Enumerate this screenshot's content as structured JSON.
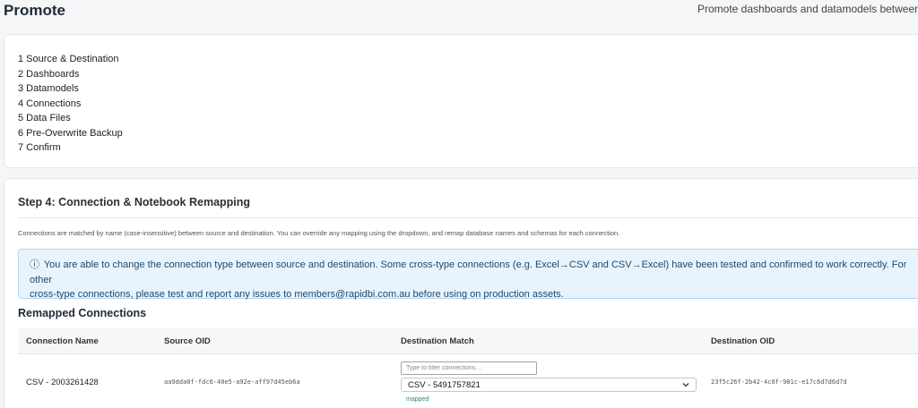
{
  "header": {
    "title": "Promote",
    "subtitle": "Promote dashboards and datamodels between env"
  },
  "steps": [
    "1 Source & Destination",
    "2 Dashboards",
    "3 Datamodels",
    "4 Connections",
    "5 Data Files",
    "6 Pre-Overwrite Backup",
    "7 Confirm"
  ],
  "step4": {
    "heading": "Step 4: Connection & Notebook Remapping",
    "description": "Connections are matched by name (case-insensitive) between source and destination. You can override any mapping using the dropdown, and remap database names and schemas for each connection.",
    "info_icon": "ⓘ",
    "info_line1": "You are able to change the connection type between source and destination. Some cross-type connections (e.g. Excel→CSV and CSV→Excel) have been tested and confirmed to work correctly. For other",
    "info_line2": "cross-type connections, please test and report any issues to members@rapidbi.com.au before using on production assets.",
    "section_heading": "Remapped Connections"
  },
  "table": {
    "columns": [
      "Connection Name",
      "Source OID",
      "Destination Match",
      "Destination OID"
    ],
    "rows": [
      {
        "name": "CSV - 2003261428",
        "source_oid": "aa9dda0f-fdc6-40e5-a92e-aff97d45eb6a",
        "filter_placeholder": "Type to filter connections...",
        "destination_match": "CSV - 5491757821",
        "status": "mapped",
        "destination_oid": "23f5c26f-2b42-4c0f-981c-e17c6d7d6d7d"
      }
    ]
  },
  "icons": {
    "select_chevron": "chevron-down-icon",
    "info": "info-icon"
  },
  "colors": {
    "info_bg": "#e8f3fc",
    "info_border": "#b6d6f0",
    "mapped_text": "#2e8b57"
  }
}
